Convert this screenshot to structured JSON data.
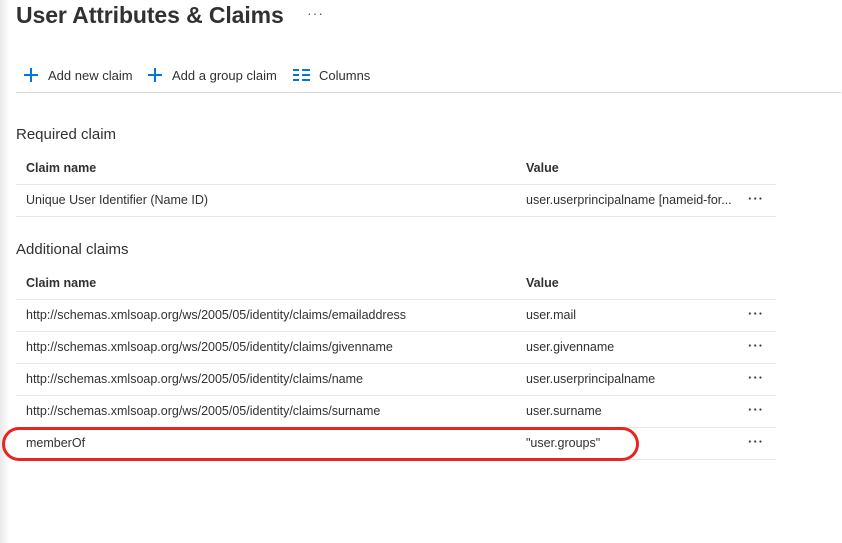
{
  "page": {
    "title": "User Attributes & Claims",
    "more_label": "···"
  },
  "toolbar": {
    "add_new_claim": "Add new claim",
    "add_group_claim": "Add a group claim",
    "columns": "Columns"
  },
  "required": {
    "section_title": "Required claim",
    "headers": {
      "name": "Claim name",
      "value": "Value"
    },
    "rows": [
      {
        "name": "Unique User Identifier (Name ID)",
        "value": "user.userprincipalname [nameid-for..."
      }
    ]
  },
  "additional": {
    "section_title": "Additional claims",
    "headers": {
      "name": "Claim name",
      "value": "Value"
    },
    "rows": [
      {
        "name": "http://schemas.xmlsoap.org/ws/2005/05/identity/claims/emailaddress",
        "value": "user.mail"
      },
      {
        "name": "http://schemas.xmlsoap.org/ws/2005/05/identity/claims/givenname",
        "value": "user.givenname"
      },
      {
        "name": "http://schemas.xmlsoap.org/ws/2005/05/identity/claims/name",
        "value": "user.userprincipalname"
      },
      {
        "name": "http://schemas.xmlsoap.org/ws/2005/05/identity/claims/surname",
        "value": "user.surname"
      },
      {
        "name": "memberOf",
        "value": "\"user.groups\""
      }
    ]
  },
  "colors": {
    "accent": "#0078d4",
    "highlight": "#e8261f"
  }
}
